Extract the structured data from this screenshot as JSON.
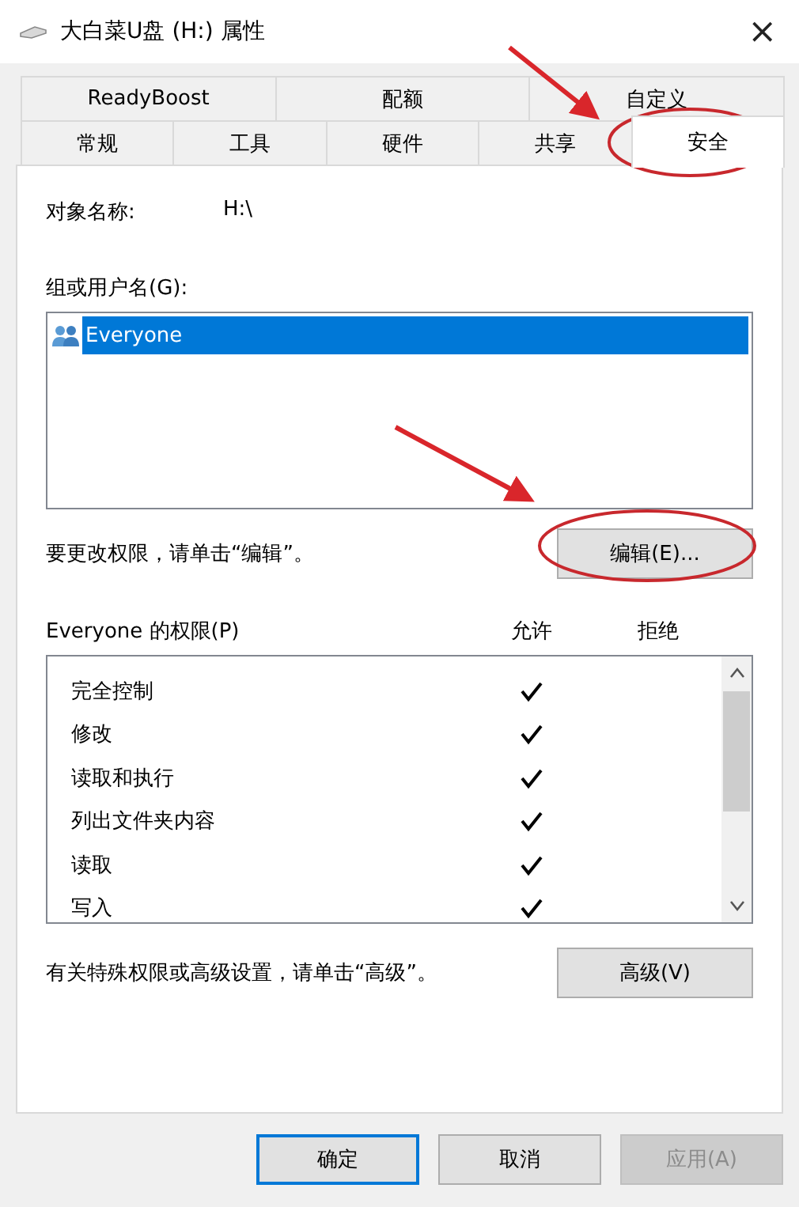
{
  "window": {
    "title": "大白菜U盘 (H:) 属性",
    "close": "×"
  },
  "tabs": [
    [
      {
        "label": "ReadyBoost",
        "selected": false
      },
      {
        "label": "配额",
        "selected": false
      },
      {
        "label": "自定义",
        "selected": false
      }
    ],
    [
      {
        "label": "常规",
        "selected": false
      },
      {
        "label": "工具",
        "selected": false
      },
      {
        "label": "硬件",
        "selected": false
      },
      {
        "label": "共享",
        "selected": false
      },
      {
        "label": "安全",
        "selected": true
      }
    ]
  ],
  "object_name": {
    "label": "对象名称:",
    "value": "H:\\"
  },
  "groups": {
    "label": "组或用户名(G):",
    "items": [
      {
        "name": "Everyone",
        "selected": true
      }
    ]
  },
  "edit_hint": "要更改权限，请单击“编辑”。",
  "edit_button": "编辑(E)...",
  "permissions": {
    "label": "Everyone 的权限(P)",
    "allow_header": "允许",
    "deny_header": "拒绝",
    "rows": [
      {
        "name": "完全控制",
        "allow": true,
        "deny": false
      },
      {
        "name": "修改",
        "allow": true,
        "deny": false
      },
      {
        "name": "读取和执行",
        "allow": true,
        "deny": false
      },
      {
        "name": "列出文件夹内容",
        "allow": true,
        "deny": false
      },
      {
        "name": "读取",
        "allow": true,
        "deny": false
      },
      {
        "name": "写入",
        "allow": true,
        "deny": false
      }
    ]
  },
  "advanced_hint": "有关特殊权限或高级设置，请单击“高级”。",
  "advanced_button": "高级(V)",
  "buttons": [
    {
      "label": "确定",
      "default": true,
      "disabled": false
    },
    {
      "label": "取消",
      "default": false,
      "disabled": false
    },
    {
      "label": "应用(A)",
      "default": false,
      "disabled": true
    }
  ]
}
